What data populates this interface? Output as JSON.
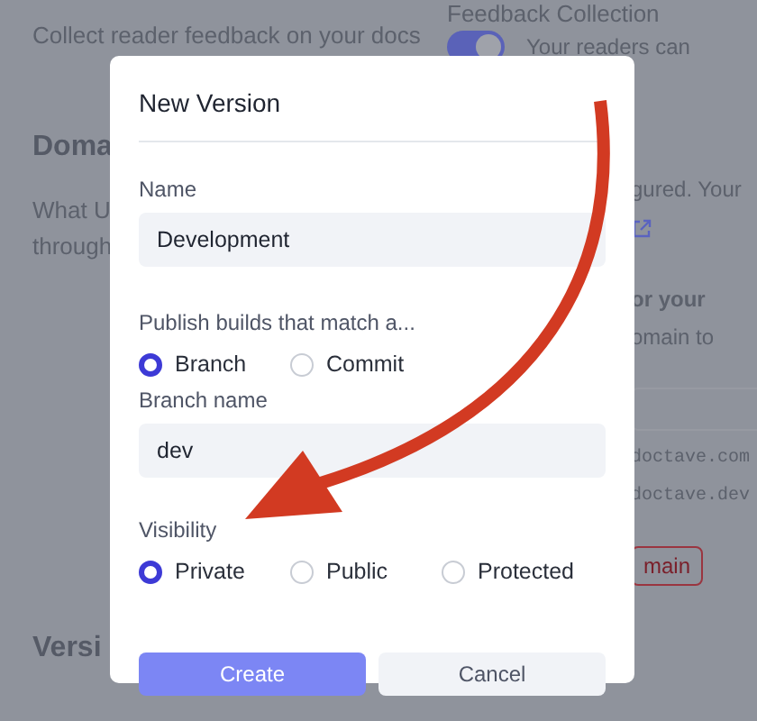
{
  "background": {
    "left": {
      "description": "Collect reader feedback on your docs",
      "section_heading": "Doma",
      "section_text": [
        "What U",
        "through"
      ],
      "bottom_heading": "Versi"
    },
    "right": {
      "heading": "Feedback Collection",
      "toggle": {
        "on": true
      },
      "toggle_text": "Your readers can",
      "note": "gured. Your",
      "subheading": "or your",
      "subtext": "omain to",
      "domains": [
        "doctave.com",
        "doctave.dev"
      ],
      "button": "main"
    }
  },
  "dialog": {
    "title": "New Version",
    "fields": [
      {
        "kind": "text",
        "label": "Name",
        "value": "Development"
      },
      {
        "kind": "radio",
        "label": "Publish builds that match a...",
        "options": [
          {
            "label": "Branch",
            "selected": true
          },
          {
            "label": "Commit",
            "selected": false
          }
        ]
      },
      {
        "kind": "text",
        "label": "Branch name",
        "value": "dev"
      },
      {
        "kind": "radio",
        "label": "Visibility",
        "options": [
          {
            "label": "Private",
            "selected": true
          },
          {
            "label": "Public",
            "selected": false
          },
          {
            "label": "Protected",
            "selected": false
          }
        ]
      }
    ],
    "buttons": [
      {
        "label": "Create",
        "kind": "primary"
      },
      {
        "label": "Cancel",
        "kind": "secondary"
      }
    ]
  }
}
